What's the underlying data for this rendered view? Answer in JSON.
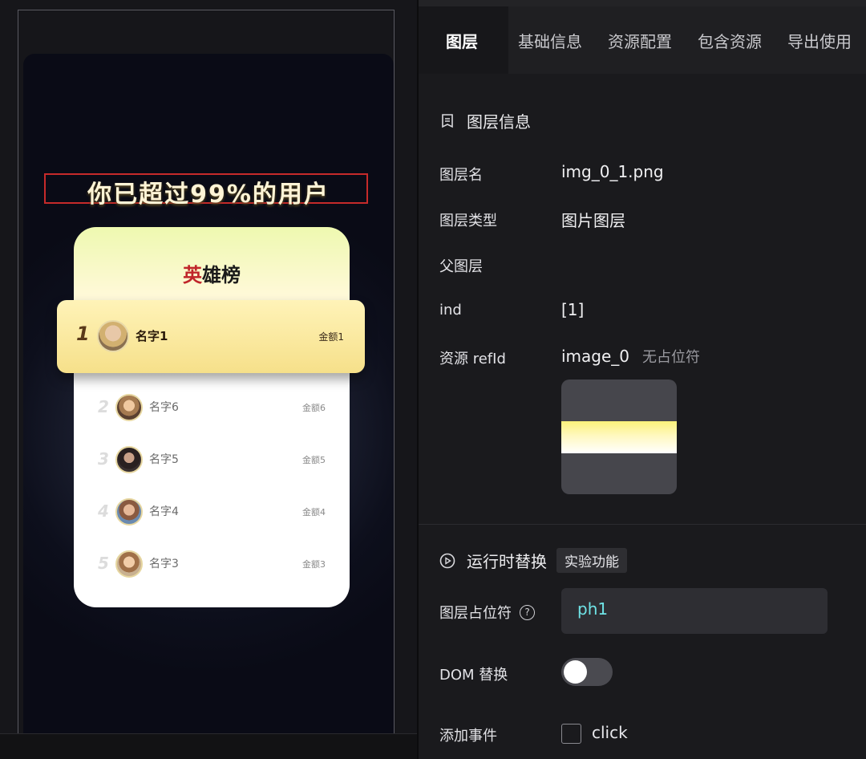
{
  "preview": {
    "headline": "你已超过99%的用户",
    "board": {
      "title_accent": "英",
      "title_rest": "雄榜",
      "top": {
        "rank": "1",
        "name": "名字1",
        "amount": "金额1"
      },
      "rows": [
        {
          "rank": "2",
          "name": "名字6",
          "amount": "金额6"
        },
        {
          "rank": "3",
          "name": "名字5",
          "amount": "金额5"
        },
        {
          "rank": "4",
          "name": "名字4",
          "amount": "金额4"
        },
        {
          "rank": "5",
          "name": "名字3",
          "amount": "金额3"
        }
      ]
    }
  },
  "tabs": [
    {
      "label": "图层",
      "active": true
    },
    {
      "label": "基础信息"
    },
    {
      "label": "资源配置"
    },
    {
      "label": "包含资源"
    },
    {
      "label": "导出使用"
    }
  ],
  "layer_info": {
    "section_title": "图层信息",
    "fields": {
      "name_label": "图层名",
      "name_value": "img_0_1.png",
      "type_label": "图层类型",
      "type_value": "图片图层",
      "parent_label": "父图层",
      "ind_label": "ind",
      "ind_value": "[1]",
      "ref_label": "资源 refId",
      "ref_value": "image_0",
      "ref_note": "无占位符"
    }
  },
  "runtime": {
    "section_title": "运行时替换",
    "badge": "实验功能",
    "placeholder_label": "图层占位符",
    "placeholder_value": "ph1",
    "help_glyph": "?",
    "dom_label": "DOM 替换",
    "dom_enabled": false,
    "event_label": "添加事件",
    "event_option": "click",
    "event_checked": false
  },
  "colors": {
    "accent_cyan": "#6fe3e6",
    "highlight_red": "#c62a2a",
    "panel_bg": "#1a1a1d"
  }
}
